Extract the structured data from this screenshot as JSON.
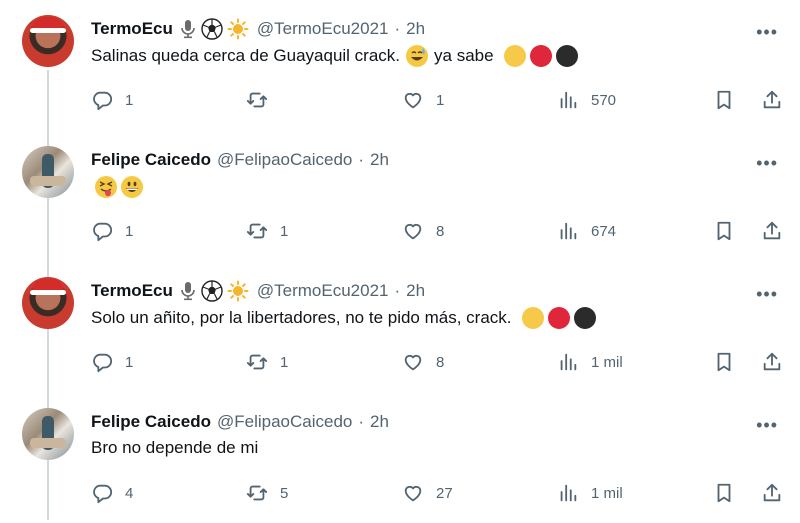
{
  "tweets": [
    {
      "name": "TermoEcu",
      "handle": "@TermoEcu2021",
      "sep": "·",
      "time": "2h",
      "text": "Salinas queda cerca de Guayaquil crack.",
      "text_after": "ya sabe",
      "replies": "1",
      "retweets": "",
      "likes": "1",
      "views": "570",
      "avatar": "termo"
    },
    {
      "name": "Felipe Caicedo",
      "handle": "@FelipaoCaicedo",
      "sep": "·",
      "time": "2h",
      "text": "",
      "text_after": "",
      "replies": "1",
      "retweets": "1",
      "likes": "8",
      "views": "674",
      "avatar": "felipe"
    },
    {
      "name": "TermoEcu",
      "handle": "@TermoEcu2021",
      "sep": "·",
      "time": "2h",
      "text": "Solo un añito, por la libertadores, no te pido más, crack.",
      "text_after": "",
      "replies": "1",
      "retweets": "1",
      "likes": "8",
      "views": "1 mil",
      "avatar": "termo"
    },
    {
      "name": "Felipe Caicedo",
      "handle": "@FelipaoCaicedo",
      "sep": "·",
      "time": "2h",
      "text": "Bro no depende de mi",
      "text_after": "",
      "replies": "4",
      "retweets": "5",
      "likes": "27",
      "views": "1 mil",
      "avatar": "felipe"
    }
  ],
  "more_label": "•••",
  "colors": {
    "ecuador_yellow": "#f7c948",
    "ecuador_red": "#e0263a",
    "black_circle": "#2b2b2b",
    "muted": "#536471",
    "thread_line": "#cfd9de"
  },
  "icons": [
    "reply-icon",
    "retweet-icon",
    "like-icon",
    "views-icon",
    "bookmark-icon",
    "share-icon",
    "microphone-icon",
    "soccer-ball-icon",
    "sun-icon",
    "more-icon"
  ]
}
